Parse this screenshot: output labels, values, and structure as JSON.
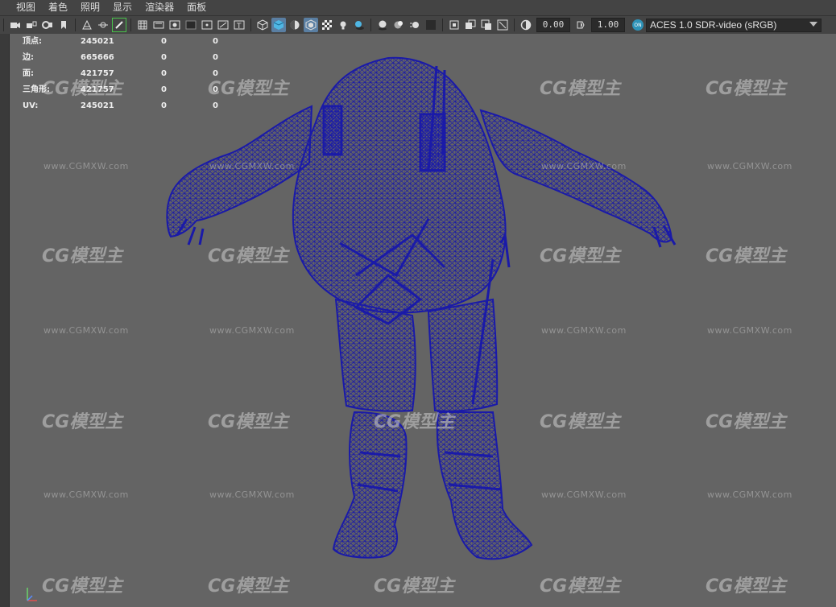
{
  "menu": [
    "视图",
    "着色",
    "照明",
    "显示",
    "渲染器",
    "面板"
  ],
  "toolbar": {
    "icons": [
      "camera-icon",
      "camera-lock-icon",
      "camera-attributes-icon",
      "bookmark-icon",
      "image-plane-icon",
      "pivot-icon",
      "grease-pencil-icon",
      "grid-icon",
      "film-gate-icon",
      "resolution-gate-icon",
      "gate-mask-icon",
      "field-chart-icon",
      "safe-action-icon",
      "safe-title-icon",
      "wireframe-icon",
      "smooth-shade-icon",
      "shade-wireframe-icon",
      "xray-cube-icon",
      "checker-texture-icon",
      "lights-icon",
      "shadows-icon",
      "ambient-occlusion-icon",
      "reflection-icon",
      "motion-blur-icon",
      "antialias-icon",
      "xray-icon",
      "xray-joints-icon",
      "backface-icon",
      "isolate-icon",
      "exposure-icon",
      "gamma-icon",
      "color-management-icon"
    ],
    "exposure": "0.00",
    "gamma": "1.00",
    "cm_badge": "ON",
    "color_space": "ACES 1.0 SDR-video (sRGB)"
  },
  "hud": {
    "rows": [
      {
        "label": "顶点:",
        "v1": "245021",
        "v2": "0",
        "v3": "0"
      },
      {
        "label": "边:",
        "v1": "665666",
        "v2": "0",
        "v3": "0"
      },
      {
        "label": "面:",
        "v1": "421757",
        "v2": "0",
        "v3": "0"
      },
      {
        "label": "三角形:",
        "v1": "421757",
        "v2": "0",
        "v3": "0"
      },
      {
        "label": "UV:",
        "v1": "245021",
        "v2": "0",
        "v3": "0"
      }
    ]
  },
  "watermark": {
    "logo": "CG模型主",
    "url": "www.CGMXW.com"
  },
  "colors": {
    "viewport_bg": "#646464",
    "wireframe": "#1a1aa8",
    "accent": "#5a7fa3"
  }
}
